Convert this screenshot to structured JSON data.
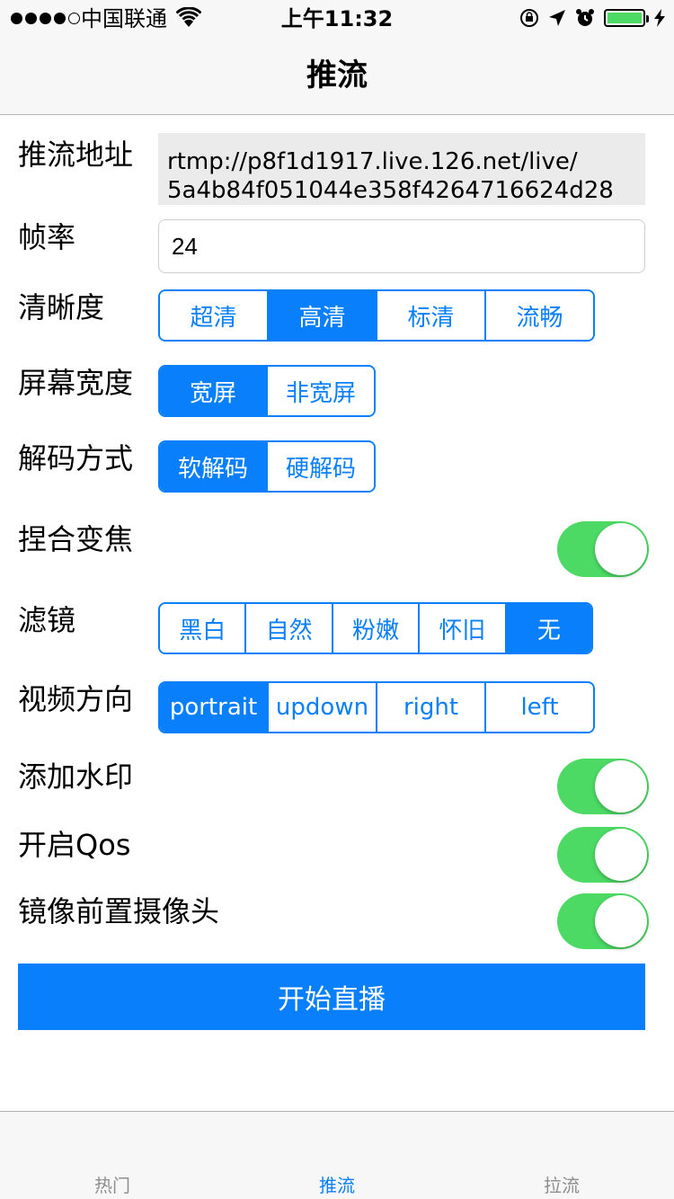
{
  "status_bar": {
    "carrier": "中国联通",
    "time": "上午11:32",
    "signal_icon": "signal-dots-icon",
    "wifi_icon": "wifi-icon",
    "battery_color": "#4cd964"
  },
  "nav": {
    "title": "推流"
  },
  "form": {
    "push_url": {
      "label": "推流地址",
      "line1": "rtmp://p8f1d1917.live.126.net/live/",
      "line2": "5a4b84f051044e358f4264716624d28"
    },
    "fps": {
      "label": "帧率",
      "value": "24"
    },
    "clarity": {
      "label": "清晰度",
      "options": [
        "超清",
        "高清",
        "标清",
        "流畅"
      ],
      "selected": 1
    },
    "screen_width": {
      "label": "屏幕宽度",
      "options": [
        "宽屏",
        "非宽屏"
      ],
      "selected": 0
    },
    "decode": {
      "label": "解码方式",
      "options": [
        "软解码",
        "硬解码"
      ],
      "selected": 0
    },
    "pinch_zoom": {
      "label": "捏合变焦",
      "on": true
    },
    "filter": {
      "label": "滤镜",
      "options": [
        "黑白",
        "自然",
        "粉嫩",
        "怀旧",
        "无"
      ],
      "selected": 4
    },
    "orientation": {
      "label": "视频方向",
      "options": [
        "portrait",
        "updown",
        "right",
        "left"
      ],
      "selected": 0
    },
    "watermark": {
      "label": "添加水印",
      "on": true
    },
    "qos": {
      "label": "开启Qos",
      "on": true
    },
    "mirror": {
      "label": "镜像前置摄像头",
      "on": true
    }
  },
  "start_button": {
    "label": "开始直播"
  },
  "tabs": [
    {
      "label": "热门",
      "active": false
    },
    {
      "label": "推流",
      "active": true
    },
    {
      "label": "拉流",
      "active": false
    }
  ],
  "colors": {
    "accent": "#0a7ffb",
    "toggle_on": "#4cd964",
    "bar_bg": "#f7f7f7"
  }
}
